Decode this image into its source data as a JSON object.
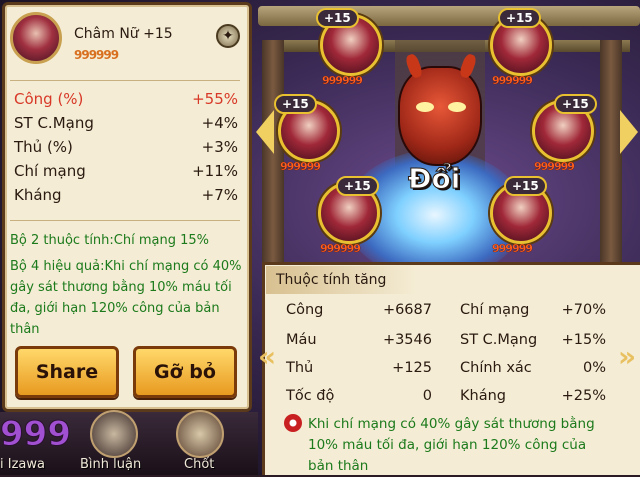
{
  "hero": {
    "name": "Châm Nữ +15",
    "stars": "999999"
  },
  "stats": [
    {
      "label": "Công (%)",
      "value": "+55%",
      "highlight": true
    },
    {
      "label": "ST C.Mạng",
      "value": "+4%"
    },
    {
      "label": "Thủ (%)",
      "value": "+3%"
    },
    {
      "label": "Chí mạng",
      "value": "+11%"
    },
    {
      "label": "Kháng",
      "value": "+7%"
    }
  ],
  "set_bonus": {
    "two": "Bộ 2 thuộc tính:Chí mạng 15%",
    "four": "Bộ 4 hiệu quả:Khi chí mạng có 40% gây sát thương bằng 10% máu tối đa, giới hạn 120% công của bản thân"
  },
  "buttons": {
    "share": "Share",
    "remove": "Gỡ bỏ"
  },
  "bottom": {
    "count": "999",
    "izawa": "i Izawa",
    "comment": "Bình luận",
    "lock": "Chốt"
  },
  "slots": [
    {
      "level": "+15",
      "stars": "999999"
    },
    {
      "level": "+15",
      "stars": "999999"
    },
    {
      "level": "+15",
      "stars": "999999"
    },
    {
      "level": "+15",
      "stars": "999999"
    },
    {
      "level": "+15",
      "stars": "999999"
    },
    {
      "level": "+15",
      "stars": "999999"
    }
  ],
  "center": {
    "change_label": "Đổi"
  },
  "attributes": {
    "title": "Thuộc tính tăng",
    "left": [
      {
        "label": "Công",
        "value": "+6687"
      },
      {
        "label": "Máu",
        "value": "+3546"
      },
      {
        "label": "Thủ",
        "value": "+125"
      },
      {
        "label": "Tốc độ",
        "value": "0"
      }
    ],
    "right": [
      {
        "label": "Chí mạng",
        "value": "+70%"
      },
      {
        "label": "ST C.Mạng",
        "value": "+15%"
      },
      {
        "label": "Chính xác",
        "value": "0%"
      },
      {
        "label": "Kháng",
        "value": "+25%"
      }
    ],
    "bonus_text": "Khi chí mạng có 40% gây sát thương bằng 10% máu tối đa, giới hạn 120% công của bản thân"
  },
  "colors": {
    "highlight": "#d83828",
    "green_text": "#1c7a1c",
    "button": "#f0b840"
  }
}
